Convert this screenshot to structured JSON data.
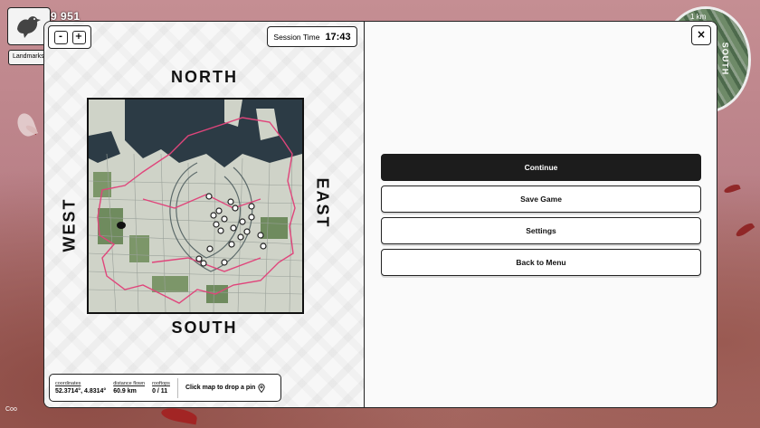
{
  "hud": {
    "score": "9 951",
    "landmark_label": "Landmarks",
    "avatar_icon": "pigeon-icon",
    "bottom_status": "Coo"
  },
  "minimap": {
    "direction_label": "SOUTH",
    "scale_label": "1 km"
  },
  "map_panel": {
    "zoom_out_label": "-",
    "zoom_in_label": "+",
    "session_label": "Session Time",
    "session_value": "17:43",
    "compass": {
      "north": "NORTH",
      "south": "SOUTH",
      "west": "WEST",
      "east": "EAST"
    },
    "stats": {
      "coordinates_label": "coordinates",
      "coordinates_value": "52.3714°, 4.8314°",
      "distance_label": "distance flown",
      "distance_value": "60.9 km",
      "rooftops_label": "rooftops",
      "rooftops_value": "0 / 11"
    },
    "drop_hint": "Click map to drop a pin",
    "drop_hint_icon": "map-pin-icon"
  },
  "pause_menu": {
    "close_label": "×",
    "buttons": [
      {
        "label": "Continue",
        "primary": true
      },
      {
        "label": "Save Game",
        "primary": false
      },
      {
        "label": "Settings",
        "primary": false
      },
      {
        "label": "Back to Menu",
        "primary": false
      }
    ]
  },
  "colors": {
    "flight_path": "#e0457b",
    "panel_border": "#222222",
    "primary_button": "#1c1c1c",
    "background_tint": "#b98087"
  }
}
